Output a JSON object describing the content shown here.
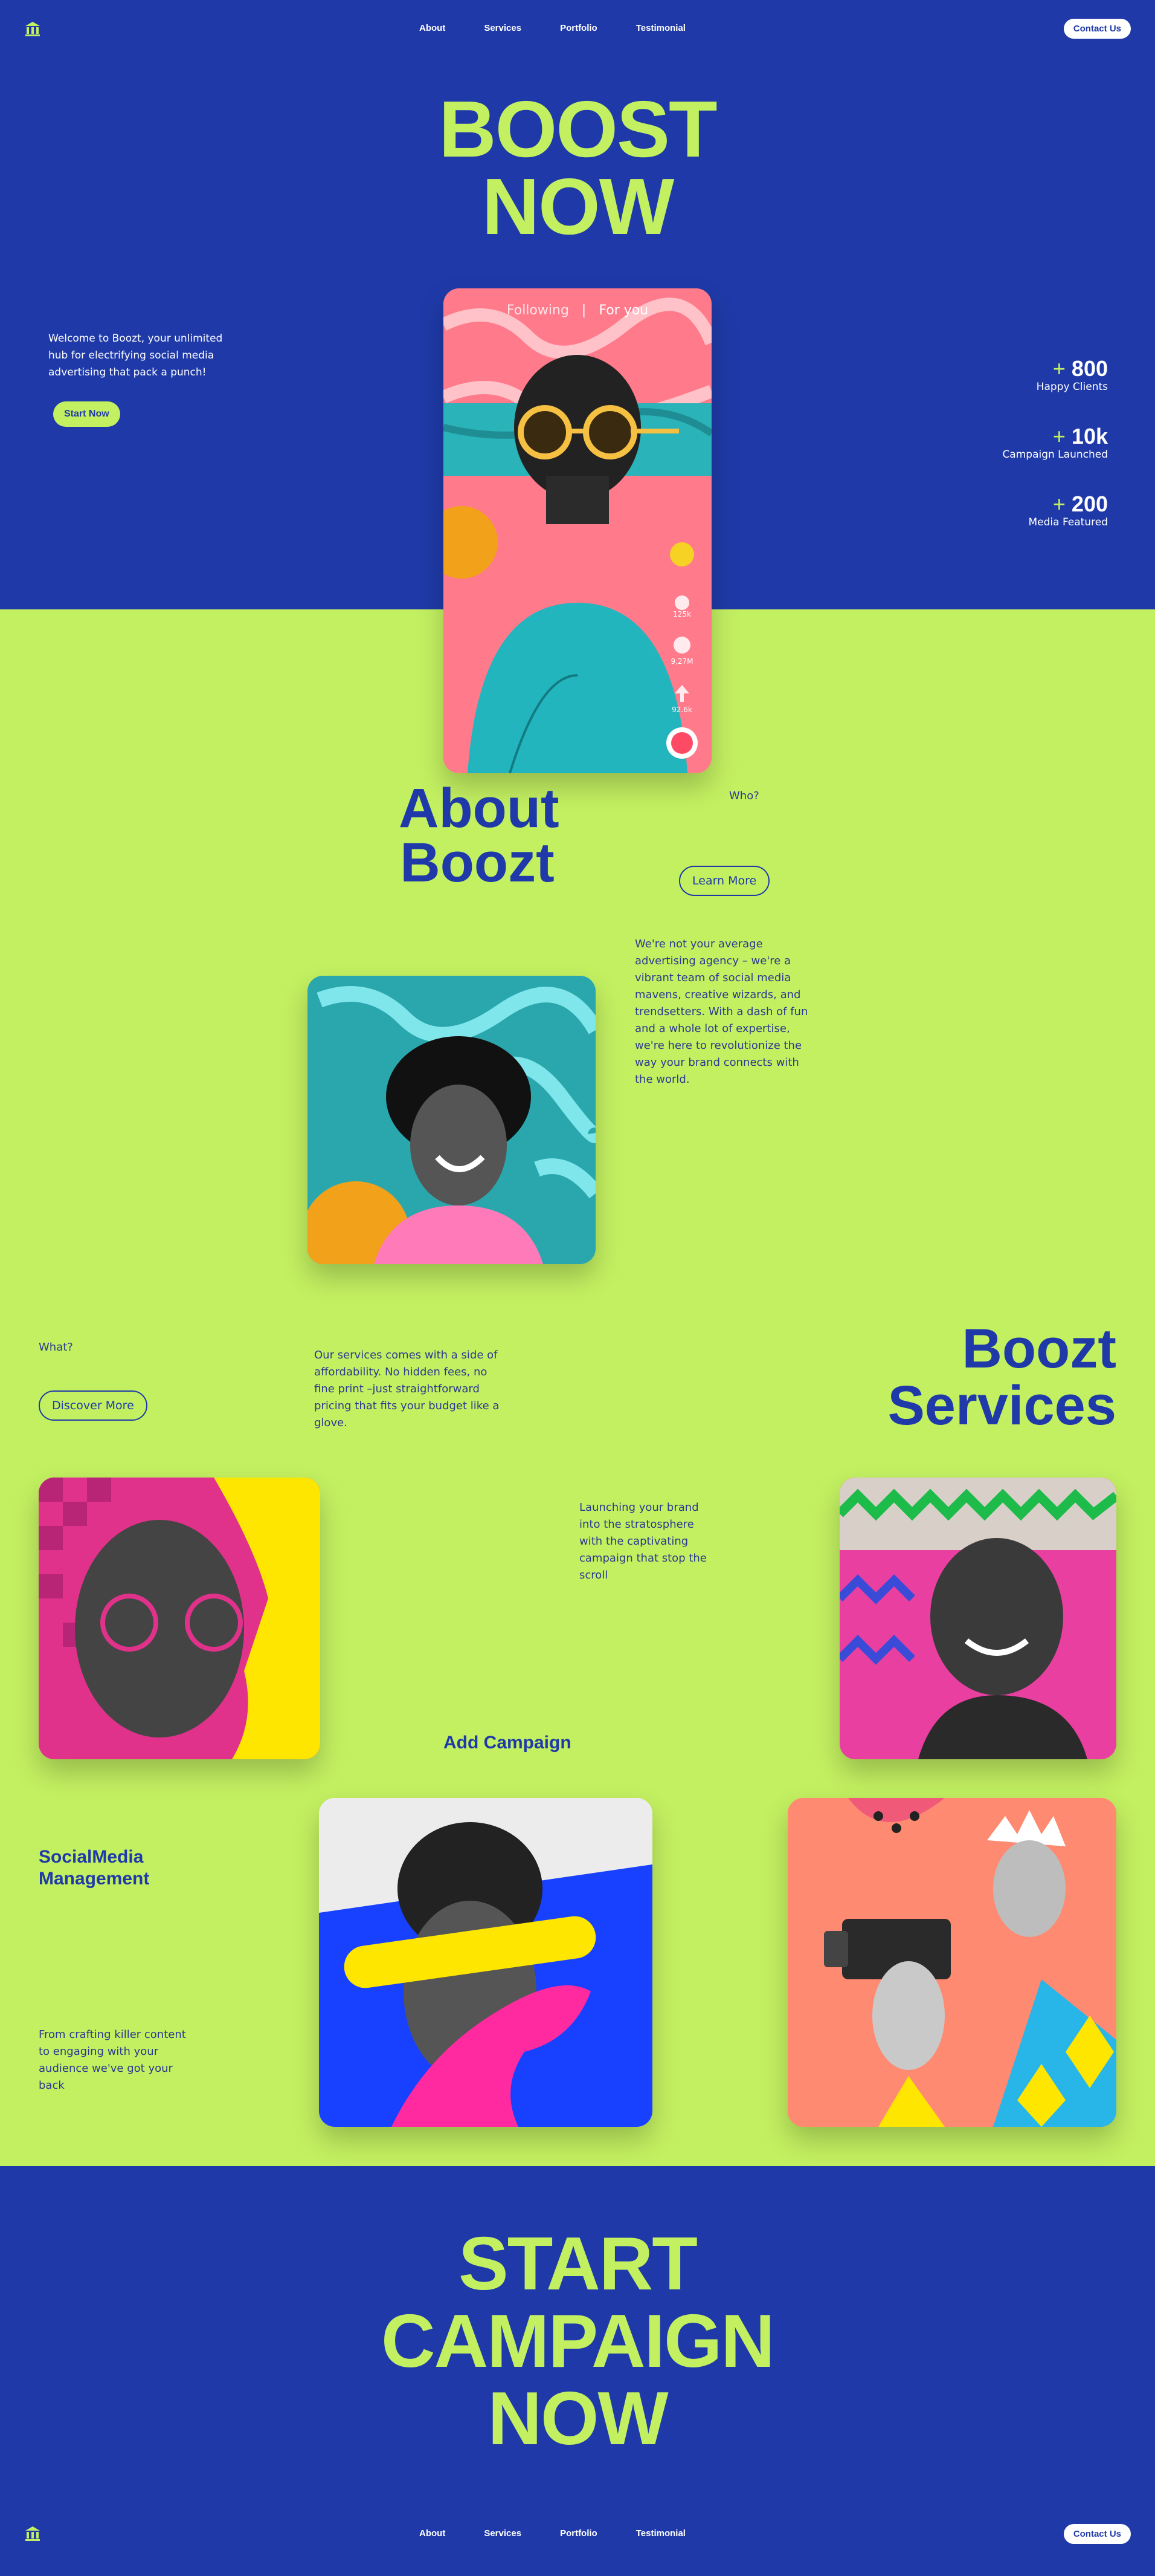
{
  "nav": {
    "logo_icon": "building-columns-icon",
    "links": [
      "About",
      "Services",
      "Portfolio",
      "Testimonial"
    ],
    "contact_label": "Contact Us"
  },
  "hero": {
    "title_line1": "BOOST",
    "title_line2": "NOW",
    "intro": "Welcome to Boozt, your unlimited hub for electrifying social media advertising that pack a punch!",
    "cta_label": "Start Now",
    "phone_tabs": [
      "Following",
      "For you"
    ],
    "phone_stats": [
      "125k",
      "9,27M",
      "92.6k"
    ],
    "stats": [
      {
        "value": "800",
        "label": "Happy Clients"
      },
      {
        "value": "10k",
        "label": "Campaign Launched"
      },
      {
        "value": "200",
        "label": "Media Featured"
      }
    ],
    "stat_prefix": "+"
  },
  "about": {
    "title_line1": "About",
    "title_line2": "Boozt",
    "who_label": "Who?",
    "learn_more_label": "Learn More",
    "description": "We're not your average advertising agency – we're a vibrant team of social media mavens, creative wizards, and trendsetters. With a dash of fun and a whole lot of expertise, we're here to revolutionize the way your brand connects with the world."
  },
  "services": {
    "what_label": "What?",
    "discover_label": "Discover More",
    "description": "Our services comes with a side of affordability. No hidden fees, no fine print –just straightforward pricing that fits your budget like a glove.",
    "title_line1": "Boozt",
    "title_line2": "Services",
    "campaign_text": "Launching your brand into the stratosphere with the captivating campaign that stop the scroll",
    "add_campaign_label": "Add Campaign",
    "social_title_line1": "SocialMedia",
    "social_title_line2": "Management",
    "social_text": "From crafting killer content to engaging with your audience we've got your back"
  },
  "cta": {
    "line1": "START",
    "line2": "CAMPAIGN",
    "line3": "NOW"
  },
  "colors": {
    "blue": "#1f3aa8",
    "lime": "#c3f061",
    "white": "#ffffff"
  }
}
